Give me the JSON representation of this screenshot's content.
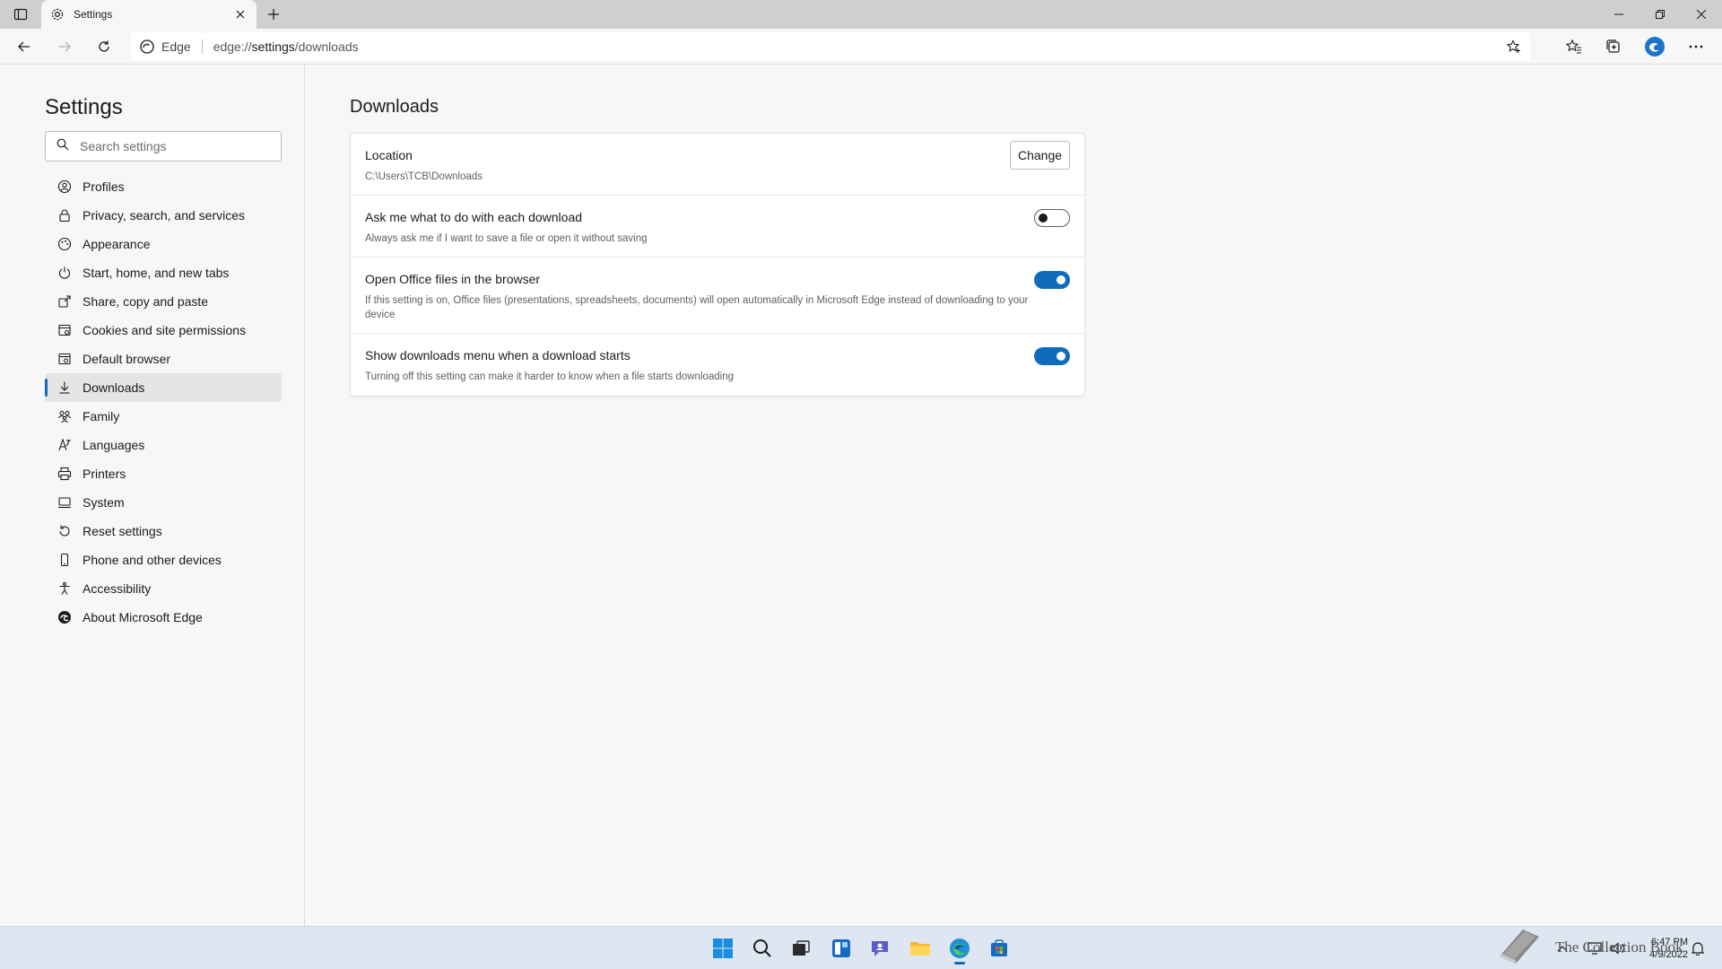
{
  "browser": {
    "tab_title": "Settings",
    "site_name": "Edge",
    "url_prefix": "edge://",
    "url_path": "settings",
    "url_suffix": "/downloads"
  },
  "sidebar": {
    "title": "Settings",
    "search_placeholder": "Search settings",
    "items": [
      {
        "label": "Profiles",
        "icon": "profile-icon"
      },
      {
        "label": "Privacy, search, and services",
        "icon": "lock-icon"
      },
      {
        "label": "Appearance",
        "icon": "appearance-icon"
      },
      {
        "label": "Start, home, and new tabs",
        "icon": "power-icon"
      },
      {
        "label": "Share, copy and paste",
        "icon": "share-icon"
      },
      {
        "label": "Cookies and site permissions",
        "icon": "cookies-icon"
      },
      {
        "label": "Default browser",
        "icon": "browser-icon"
      },
      {
        "label": "Downloads",
        "icon": "download-icon",
        "active": true
      },
      {
        "label": "Family",
        "icon": "family-icon"
      },
      {
        "label": "Languages",
        "icon": "language-icon"
      },
      {
        "label": "Printers",
        "icon": "printer-icon"
      },
      {
        "label": "System",
        "icon": "system-icon"
      },
      {
        "label": "Reset settings",
        "icon": "reset-icon"
      },
      {
        "label": "Phone and other devices",
        "icon": "phone-icon"
      },
      {
        "label": "Accessibility",
        "icon": "accessibility-icon"
      },
      {
        "label": "About Microsoft Edge",
        "icon": "edge-icon"
      }
    ]
  },
  "main": {
    "title": "Downloads",
    "location": {
      "title": "Location",
      "path": "C:\\Users\\TCB\\Downloads",
      "change_label": "Change"
    },
    "settings": [
      {
        "title": "Ask me what to do with each download",
        "desc": "Always ask me if I want to save a file or open it without saving",
        "enabled": false
      },
      {
        "title": "Open Office files in the browser",
        "desc": "If this setting is on, Office files (presentations, spreadsheets, documents) will open automatically in Microsoft Edge instead of downloading to your device",
        "enabled": true
      },
      {
        "title": "Show downloads menu when a download starts",
        "desc": "Turning off this setting can make it harder to know when a file starts downloading",
        "enabled": true
      }
    ]
  },
  "taskbar": {
    "time": "6:47 PM",
    "date": "4/9/2022",
    "watermark": "The Collection Book"
  },
  "colors": {
    "accent": "#0f6cbd",
    "taskbar": "#dde6f1"
  }
}
